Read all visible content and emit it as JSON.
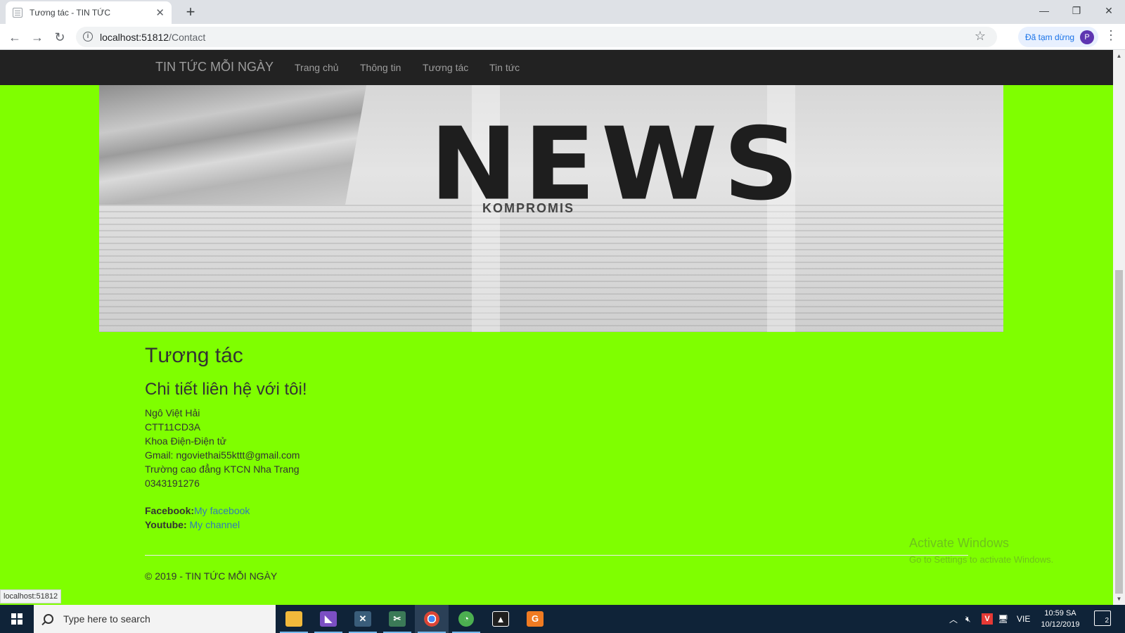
{
  "browser": {
    "tab_title": "Tương tác - TIN TỨC",
    "tab_close": "✕",
    "new_tab": "+",
    "minimize": "—",
    "restore": "❐",
    "close": "✕",
    "url_host": "localhost:51812",
    "url_path": "/Contact",
    "back": "←",
    "forward": "→",
    "reload": "↻",
    "bookmark_star": "☆",
    "profile_label": "Đã tạm dừng",
    "profile_initial": "P",
    "menu": "⋮",
    "status_link": "localhost:51812"
  },
  "site": {
    "brand": "TIN TỨC MỖI NGÀY",
    "nav": [
      "Trang chủ",
      "Thông tin",
      "Tương tác",
      "Tin tức"
    ],
    "banner_word": "NEWS",
    "banner_sub": "KOMPROMIS"
  },
  "contact": {
    "title": "Tương tác",
    "subtitle": "Chi tiết liên hệ với tôi!",
    "lines": [
      "Ngô Việt Hải",
      "CTT11CD3A",
      "Khoa Điện-Điện tử",
      "Gmail: ngoviethai55kttt@gmail.com",
      "Trường cao đẳng KTCN Nha Trang",
      "0343191276"
    ],
    "facebook_label": "Facebook:",
    "facebook_link": "My facebook",
    "youtube_label": "Youtube:",
    "youtube_link": "My channel"
  },
  "footer": {
    "text": "© 2019 - TIN TỨC MỖI NGÀY"
  },
  "windows_watermark": {
    "line1": "Activate Windows",
    "line2": "Go to Settings to activate Windows."
  },
  "taskbar": {
    "search_placeholder": "Type here to search",
    "lang": "VIE",
    "time": "10:59 SA",
    "date": "10/12/2019",
    "notification_count": "2",
    "colors": {
      "taskbar_bg": "#0f2338",
      "page_bg": "#7fff00",
      "navbar_bg": "#222222",
      "link": "#337ab7"
    }
  }
}
